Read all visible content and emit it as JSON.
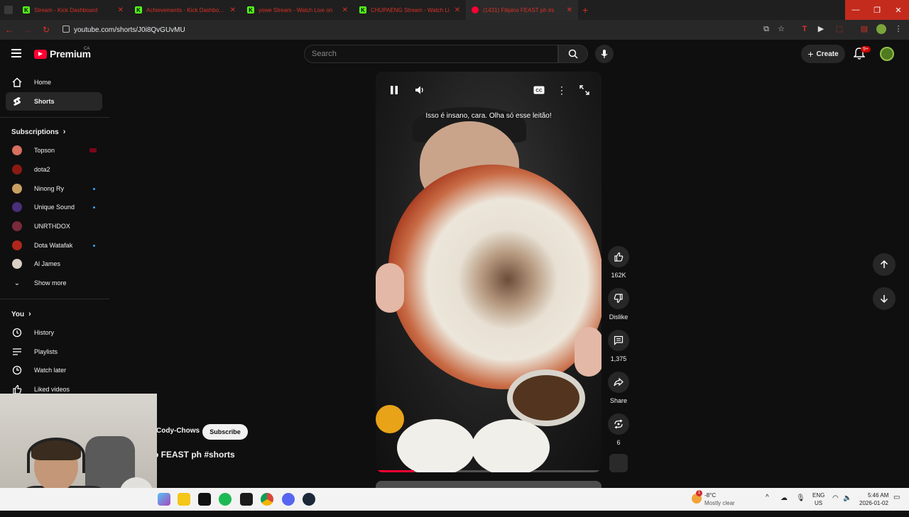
{
  "browser": {
    "tabs": [
      {
        "label": "Stream - Kick Dashboard",
        "favicon": "kick"
      },
      {
        "label": "Achievements - Kick Dashboard",
        "favicon": "kick"
      },
      {
        "label": "yowe Stream - Watch Live on",
        "favicon": "kick"
      },
      {
        "label": "CHUPAENG Stream - Watch Li",
        "favicon": "kick"
      },
      {
        "label": "(1431) Filipino FEAST ph #s",
        "favicon": "youtube"
      }
    ],
    "new_tab": "+",
    "url": "youtube.com/shorts/J0i8QvGUvMU"
  },
  "header": {
    "logo_text": "Premium",
    "country": "CA",
    "search_placeholder": "Search",
    "create_label": "Create",
    "notification_count": "9+"
  },
  "sidebar": {
    "main": [
      {
        "label": "Home",
        "icon": "home-icon",
        "active": false
      },
      {
        "label": "Shorts",
        "icon": "shorts-icon",
        "active": true
      }
    ],
    "subscriptions_title": "Subscriptions",
    "subscriptions": [
      {
        "label": "Topson",
        "color": "#d86f5f",
        "live": true,
        "dot": false
      },
      {
        "label": "dota2",
        "color": "#8b1a12",
        "live": false,
        "dot": false
      },
      {
        "label": "Ninong Ry",
        "color": "#c8a060",
        "live": false,
        "dot": true
      },
      {
        "label": "Unique Sound",
        "color": "#4a2f7a",
        "live": false,
        "dot": true
      },
      {
        "label": "UNRTHDOX",
        "color": "#7a2a3a",
        "live": false,
        "dot": false
      },
      {
        "label": "Dota Watafak",
        "color": "#b0261c",
        "live": false,
        "dot": true
      },
      {
        "label": "Al James",
        "color": "#d9cfc3",
        "live": false,
        "dot": false
      }
    ],
    "show_more": "Show more",
    "you_title": "You",
    "you_items": [
      {
        "label": "History",
        "icon": "history-icon"
      },
      {
        "label": "Playlists",
        "icon": "playlists-icon"
      },
      {
        "label": "Watch later",
        "icon": "watch-later-icon"
      },
      {
        "label": "Liked videos",
        "icon": "liked-videos-icon"
      }
    ]
  },
  "player": {
    "caption": "Isso é insano, cara.  Olha só esse leitão!",
    "progress": 0.17
  },
  "actions": {
    "likes": "162K",
    "dislike_label": "Dislike",
    "comments": "1,375",
    "share_label": "Share",
    "remix_count": "6"
  },
  "short_info": {
    "channel": "Cody-Chows",
    "subscribe_label": "Subscribe",
    "title": "o FEAST ph #shorts"
  },
  "taskbar": {
    "weather_temp": "-8°C",
    "weather_desc": "Mostly clear",
    "lang": "ENG",
    "region": "US",
    "time": "5:46 AM",
    "date": "2026-01-02",
    "weather_alert": "1"
  },
  "colors": {
    "accent": "#ff0033",
    "kick": "#53fc18",
    "background": "#0f0f0f"
  }
}
